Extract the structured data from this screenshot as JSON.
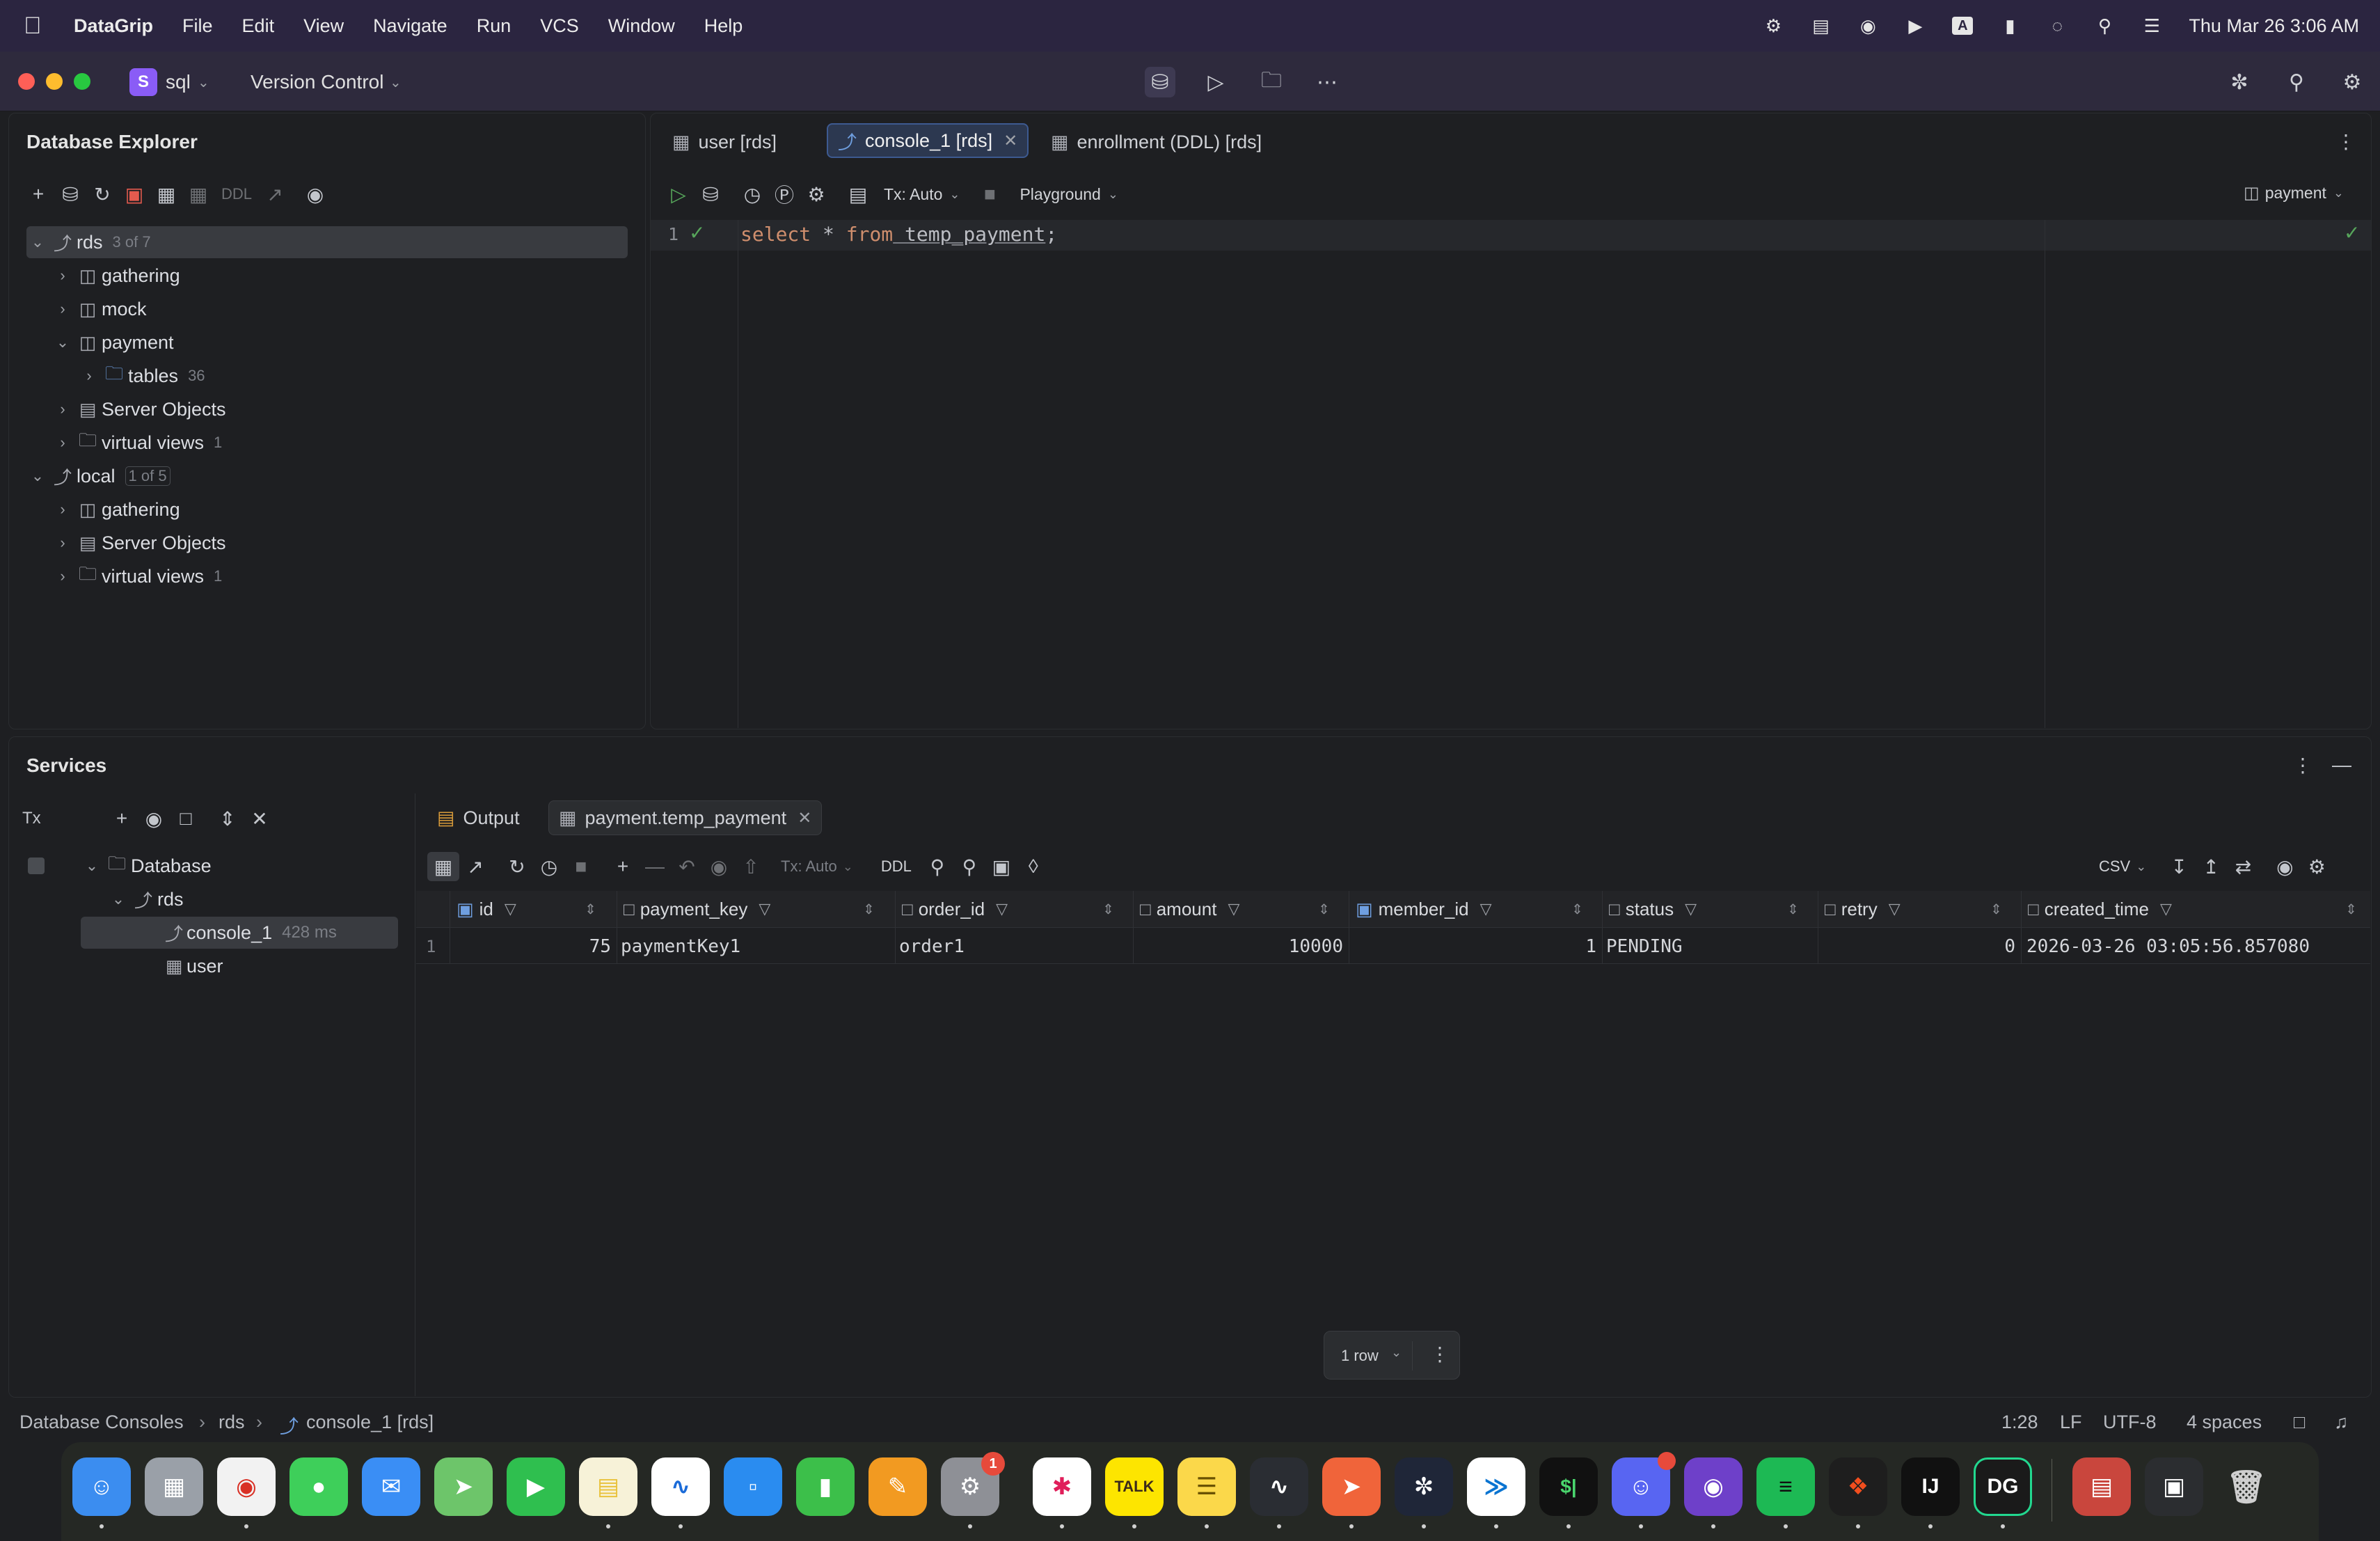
{
  "menubar": {
    "app": "DataGrip",
    "items": [
      "File",
      "Edit",
      "View",
      "Navigate",
      "Run",
      "VCS",
      "Window",
      "Help"
    ],
    "clock": "Thu Mar 26  3:06 AM"
  },
  "titlebar": {
    "project_initial": "S",
    "project_name": "sql",
    "vcs_label": "Version Control"
  },
  "db_explorer": {
    "title": "Database Explorer",
    "ddl_label": "DDL",
    "tree": [
      {
        "label": "rds",
        "count": "3 of 7"
      },
      {
        "label": "gathering"
      },
      {
        "label": "mock"
      },
      {
        "label": "payment"
      },
      {
        "label": "tables",
        "count": "36"
      },
      {
        "label": "Server Objects"
      },
      {
        "label": "virtual views",
        "count": "1"
      },
      {
        "label": "local",
        "count": "1 of 5"
      },
      {
        "label": "gathering"
      },
      {
        "label": "Server Objects"
      },
      {
        "label": "virtual views",
        "count": "1"
      }
    ]
  },
  "editor": {
    "tabs": [
      {
        "label": "user [rds]"
      },
      {
        "label": "console_1 [rds]"
      },
      {
        "label": "enrollment (DDL) [rds]"
      }
    ],
    "tx_label": "Tx: Auto",
    "playground_label": "Playground",
    "schema_label": "payment",
    "line_number": "1",
    "code": {
      "k1": "select",
      "star": " * ",
      "k2": "from",
      "table": " temp_payment",
      "semi": ";"
    }
  },
  "services": {
    "title": "Services",
    "tx_label": "Tx",
    "tree": [
      {
        "label": "Database"
      },
      {
        "label": "rds"
      },
      {
        "label": "console_1",
        "time": "428 ms"
      },
      {
        "label": "user"
      }
    ],
    "tabs": [
      {
        "label": "Output"
      },
      {
        "label": "payment.temp_payment"
      }
    ],
    "toolbar": {
      "tx_label": "Tx: Auto",
      "ddl_label": "DDL",
      "export_label": "CSV"
    },
    "columns": [
      "id",
      "payment_key",
      "order_id",
      "amount",
      "member_id",
      "status",
      "retry",
      "created_time"
    ],
    "rows": [
      {
        "num": "1",
        "id": "75",
        "payment_key": "paymentKey1",
        "order_id": "order1",
        "amount": "10000",
        "member_id": "1",
        "status": "PENDING",
        "retry": "0",
        "created_time": "2026-03-26 03:05:56.857080"
      }
    ],
    "row_count_label": "1 row"
  },
  "statusbar": {
    "breadcrumb": [
      "Database Consoles",
      "rds",
      "console_1 [rds]"
    ],
    "position": "1:28",
    "line_sep": "LF",
    "encoding": "UTF-8",
    "indent": "4 spaces"
  },
  "dock": {
    "mail_badge": "1",
    "discord_badge": "",
    "kakao_label": "TALK",
    "ij_label": "IJ",
    "dg_label": "DG",
    "terminal_label": "$|"
  }
}
